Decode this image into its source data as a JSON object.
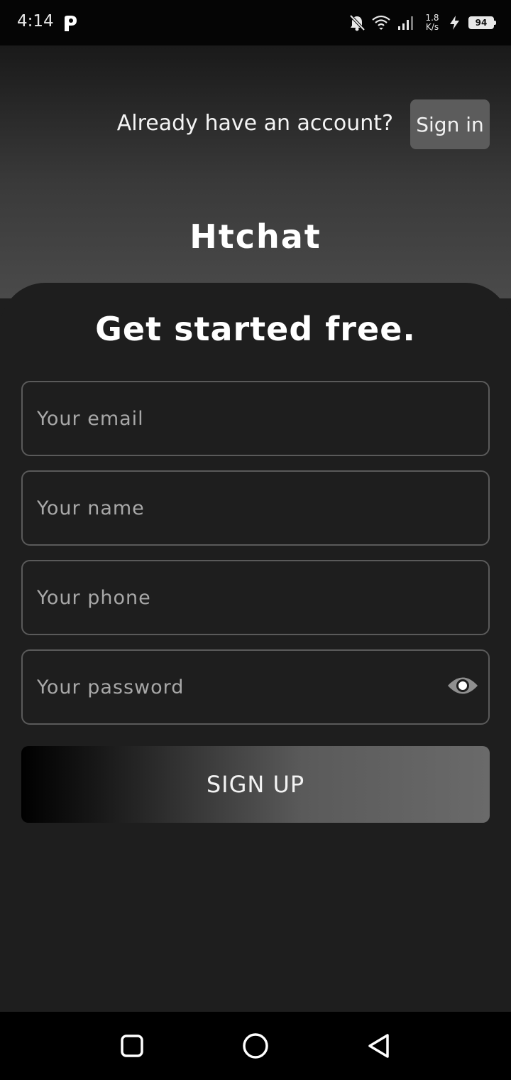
{
  "status_bar": {
    "time": "4:14",
    "net_speed_value": "1.8",
    "net_speed_unit": "K/s",
    "battery_level": "94",
    "icons": [
      "p-app-icon",
      "bell-off-icon",
      "wifi-icon",
      "signal-icon",
      "charging-icon"
    ]
  },
  "header": {
    "prompt": "Already have an account?",
    "signin_label": "Sign in",
    "app_name": "Htchat"
  },
  "form": {
    "title": "Get started free.",
    "email_placeholder": "Your email",
    "name_placeholder": "Your name",
    "phone_placeholder": "Your phone",
    "password_placeholder": "Your password",
    "email_value": "",
    "name_value": "",
    "phone_value": "",
    "password_value": "",
    "submit_label": "SIGN UP"
  },
  "colors": {
    "background": "#1e1e1e",
    "signin_button": "#5c5c5c",
    "field_border": "#5a5a5a",
    "placeholder": "#a8a8a8"
  },
  "nav_bar": {
    "icons": [
      "recents-icon",
      "home-icon",
      "back-icon"
    ]
  }
}
